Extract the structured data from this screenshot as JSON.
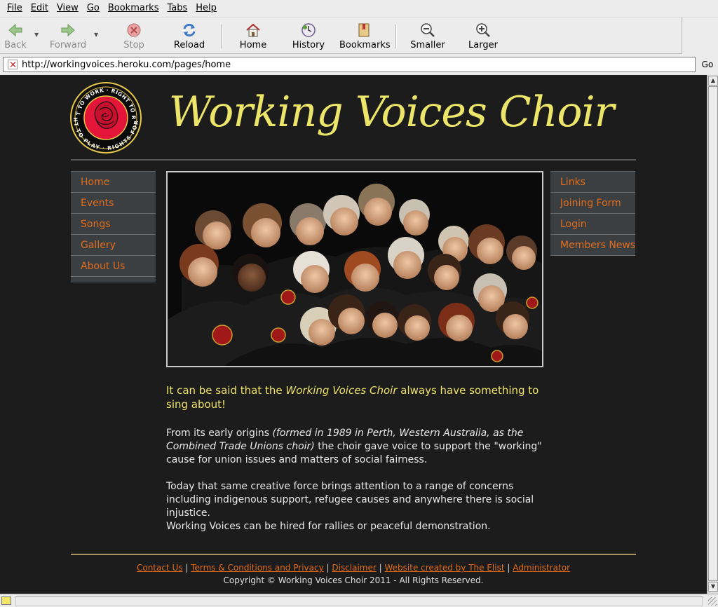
{
  "browser": {
    "menu": [
      "File",
      "Edit",
      "View",
      "Go",
      "Bookmarks",
      "Tabs",
      "Help"
    ],
    "toolbar": {
      "back": "Back",
      "forward": "Forward",
      "stop": "Stop",
      "reload": "Reload",
      "home": "Home",
      "history": "History",
      "bookmarks": "Bookmarks",
      "smaller": "Smaller",
      "larger": "Larger"
    },
    "url": "http://workingvoices.heroku.com/pages/home",
    "go_label": "Go"
  },
  "site": {
    "title": "Working Voices Choir",
    "logo_text": {
      "top": "RIGHT TO WORK · RIGHT TO REST",
      "bottom": "RIGHT TO PLAY · RIGHTS FOR ALL"
    },
    "nav_left": [
      "Home",
      "Events",
      "Songs",
      "Gallery",
      "About Us"
    ],
    "nav_right": [
      "Links",
      "Joining Form",
      "Login",
      "Members News"
    ],
    "intro": {
      "before": "It can be said that the ",
      "em": "Working Voices Choir",
      "after": " always have something to sing about!"
    },
    "para1": {
      "before": "From its early origins ",
      "em": "(formed in 1989 in Perth, Western Australia, as the Combined Trade Unions choir)",
      "after": " the choir gave voice to support the \"working\" cause for union issues and matters of social fairness."
    },
    "para2": "Today that same creative force brings attention to a range of concerns including indigenous support, refugee causes and anywhere there is social injustice.",
    "para3": "Working Voices can be hired for rallies or peaceful demonstration.",
    "footer_links": [
      "Contact Us",
      "Terms & Conditions and Privacy",
      "Disclaimer",
      "Website created by The Elist",
      "Administrator"
    ],
    "footer_separator": " | ",
    "copyright": "Copyright © Working Voices Choir 2011 - All Rights Reserved."
  },
  "colors": {
    "page_bg": "#1c1c1c",
    "title": "#ece56a",
    "nav_link": "#e36c1c",
    "nav_bg": "#3c3f42",
    "footer_rule": "#a8935a"
  }
}
